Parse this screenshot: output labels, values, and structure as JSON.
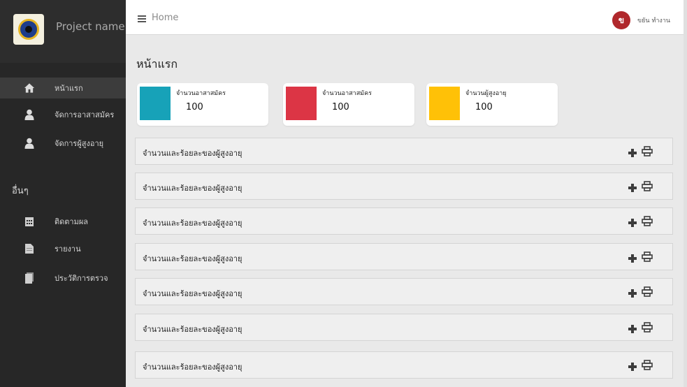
{
  "sidebar": {
    "project_name": "Project name",
    "items": [
      {
        "label": "หน้าแรก",
        "icon": "home-icon"
      },
      {
        "label": "จัดการอาสาสมัคร",
        "icon": "user-icon"
      },
      {
        "label": "จัดการผู้สูงอายุ",
        "icon": "user-icon"
      }
    ],
    "section_other": "อื่นๆ",
    "other_items": [
      {
        "label": "ติดตามผล",
        "icon": "calendar-icon"
      },
      {
        "label": "รายงาน",
        "icon": "document-icon"
      },
      {
        "label": "ประวัติการตรวจ",
        "icon": "file-copy-icon"
      }
    ]
  },
  "topbar": {
    "breadcrumb": "Home",
    "user_initial": "ข",
    "user_name": "ขยัน ทำงาน"
  },
  "main": {
    "page_title": "หน้าแรก",
    "stats": [
      {
        "label": "จำนวนอาสาสมัคร",
        "value": "100",
        "color": "#17a2b8"
      },
      {
        "label": "จำนวนอาสาสมัคร",
        "value": "100",
        "color": "#dc3545"
      },
      {
        "label": "จำนวนผู้สูงอายุ",
        "value": "100",
        "color": "#ffc107"
      }
    ],
    "panels": [
      {
        "title": "จำนวนและร้อยละของผู้สูงอายุ"
      },
      {
        "title": "จำนวนและร้อยละของผู้สูงอายุ"
      },
      {
        "title": "จำนวนและร้อยละของผู้สูงอายุ"
      },
      {
        "title": "จำนวนและร้อยละของผู้สูงอายุ"
      },
      {
        "title": "จำนวนและร้อยละของผู้สูงอายุ"
      },
      {
        "title": "จำนวนและร้อยละของผู้สูงอายุ"
      },
      {
        "title": "จำนวนและร้อยละของผู้สูงอายุ"
      }
    ]
  }
}
